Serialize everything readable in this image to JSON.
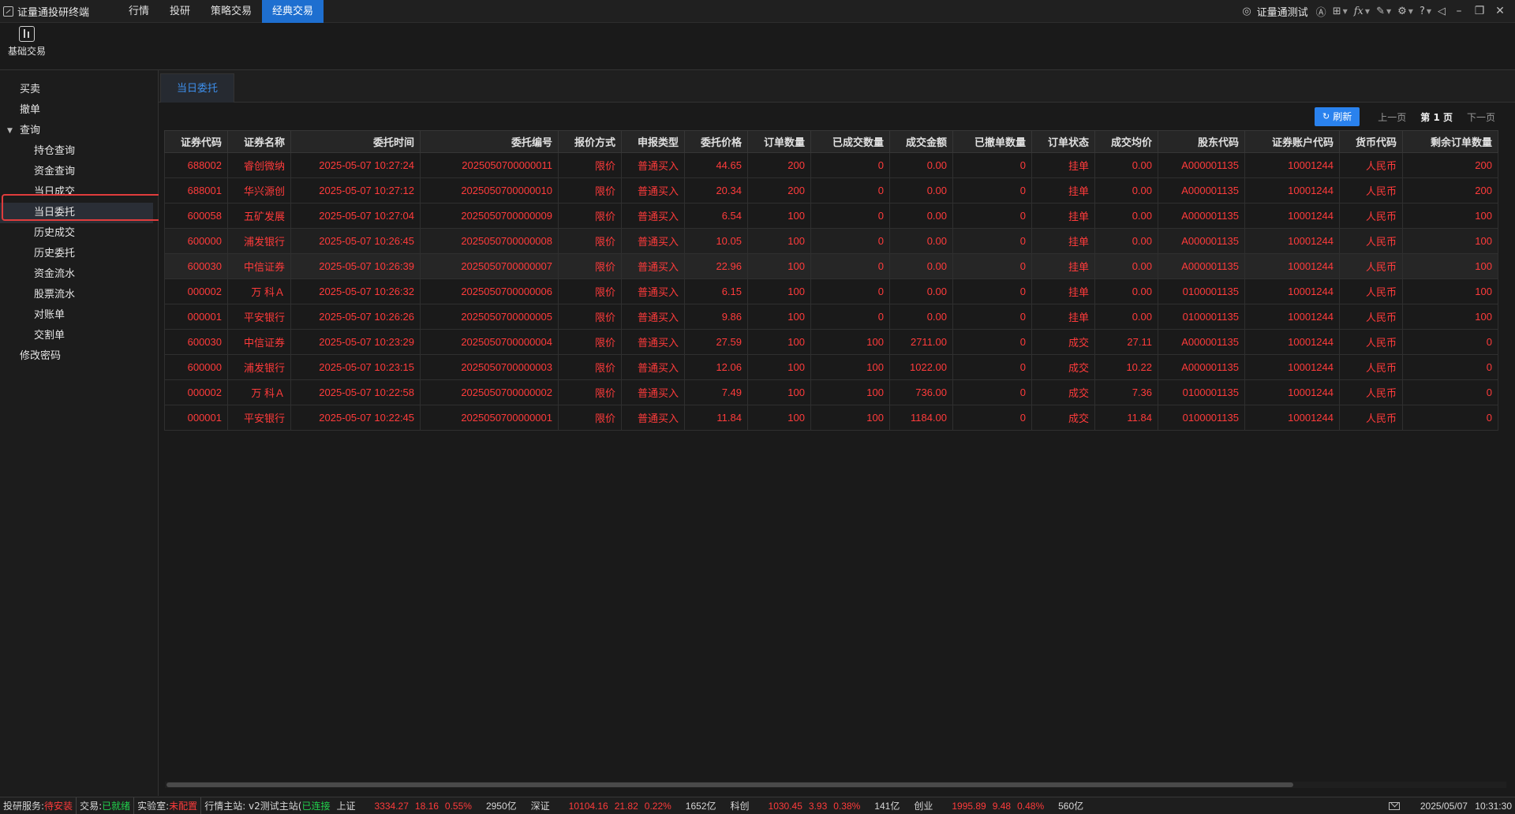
{
  "app": {
    "title": "证量通投研终端",
    "user": "证量通测试",
    "menu": [
      {
        "label": "行情",
        "active": false
      },
      {
        "label": "投研",
        "active": false
      },
      {
        "label": "策略交易",
        "active": false
      },
      {
        "label": "经典交易",
        "active": true
      }
    ]
  },
  "toolbar": {
    "basic_trade_label": "基础交易"
  },
  "sidebar": {
    "items": [
      {
        "label": "买卖",
        "level": 1
      },
      {
        "label": "撤单",
        "level": 1
      },
      {
        "label": "查询",
        "level": 1,
        "expanded": true
      },
      {
        "label": "持仓查询",
        "level": 2
      },
      {
        "label": "资金查询",
        "level": 2
      },
      {
        "label": "当日成交",
        "level": 2
      },
      {
        "label": "当日委托",
        "level": 2,
        "active": true
      },
      {
        "label": "历史成交",
        "level": 2
      },
      {
        "label": "历史委托",
        "level": 2
      },
      {
        "label": "资金流水",
        "level": 2
      },
      {
        "label": "股票流水",
        "level": 2
      },
      {
        "label": "对账单",
        "level": 2
      },
      {
        "label": "交割单",
        "level": 2
      },
      {
        "label": "修改密码",
        "level": 1
      }
    ]
  },
  "main": {
    "tab": "当日委托",
    "refresh_label": "刷新",
    "pager": {
      "prev": "上一页",
      "current": "第 1 页",
      "next": "下一页"
    },
    "columns": [
      "证券代码",
      "证券名称",
      "委托时间",
      "委托编号",
      "报价方式",
      "申报类型",
      "委托价格",
      "订单数量",
      "已成交数量",
      "成交金额",
      "已撤单数量",
      "订单状态",
      "成交均价",
      "股东代码",
      "证券账户代码",
      "货币代码",
      "剩余订单数量"
    ],
    "rows": [
      [
        "688002",
        "睿创微纳",
        "2025-05-07 10:27:24",
        "2025050700000011",
        "限价",
        "普通买入",
        "44.65",
        "200",
        "0",
        "0.00",
        "0",
        "挂单",
        "0.00",
        "A000001135",
        "10001244",
        "人民币",
        "200"
      ],
      [
        "688001",
        "华兴源创",
        "2025-05-07 10:27:12",
        "2025050700000010",
        "限价",
        "普通买入",
        "20.34",
        "200",
        "0",
        "0.00",
        "0",
        "挂单",
        "0.00",
        "A000001135",
        "10001244",
        "人民币",
        "200"
      ],
      [
        "600058",
        "五矿发展",
        "2025-05-07 10:27:04",
        "2025050700000009",
        "限价",
        "普通买入",
        "6.54",
        "100",
        "0",
        "0.00",
        "0",
        "挂单",
        "0.00",
        "A000001135",
        "10001244",
        "人民币",
        "100"
      ],
      [
        "600000",
        "浦发银行",
        "2025-05-07 10:26:45",
        "2025050700000008",
        "限价",
        "普通买入",
        "10.05",
        "100",
        "0",
        "0.00",
        "0",
        "挂单",
        "0.00",
        "A000001135",
        "10001244",
        "人民币",
        "100"
      ],
      [
        "600030",
        "中信证券",
        "2025-05-07 10:26:39",
        "2025050700000007",
        "限价",
        "普通买入",
        "22.96",
        "100",
        "0",
        "0.00",
        "0",
        "挂单",
        "0.00",
        "A000001135",
        "10001244",
        "人民币",
        "100"
      ],
      [
        "000002",
        "万 科Ａ",
        "2025-05-07 10:26:32",
        "2025050700000006",
        "限价",
        "普通买入",
        "6.15",
        "100",
        "0",
        "0.00",
        "0",
        "挂单",
        "0.00",
        "0100001135",
        "10001244",
        "人民币",
        "100"
      ],
      [
        "000001",
        "平安银行",
        "2025-05-07 10:26:26",
        "2025050700000005",
        "限价",
        "普通买入",
        "9.86",
        "100",
        "0",
        "0.00",
        "0",
        "挂单",
        "0.00",
        "0100001135",
        "10001244",
        "人民币",
        "100"
      ],
      [
        "600030",
        "中信证券",
        "2025-05-07 10:23:29",
        "2025050700000004",
        "限价",
        "普通买入",
        "27.59",
        "100",
        "100",
        "2711.00",
        "0",
        "成交",
        "27.11",
        "A000001135",
        "10001244",
        "人民币",
        "0"
      ],
      [
        "600000",
        "浦发银行",
        "2025-05-07 10:23:15",
        "2025050700000003",
        "限价",
        "普通买入",
        "12.06",
        "100",
        "100",
        "1022.00",
        "0",
        "成交",
        "10.22",
        "A000001135",
        "10001244",
        "人民币",
        "0"
      ],
      [
        "000002",
        "万 科Ａ",
        "2025-05-07 10:22:58",
        "2025050700000002",
        "限价",
        "普通买入",
        "7.49",
        "100",
        "100",
        "736.00",
        "0",
        "成交",
        "7.36",
        "0100001135",
        "10001244",
        "人民币",
        "0"
      ],
      [
        "000001",
        "平安银行",
        "2025-05-07 10:22:45",
        "2025050700000001",
        "限价",
        "普通买入",
        "11.84",
        "100",
        "100",
        "1184.00",
        "0",
        "成交",
        "11.84",
        "0100001135",
        "10001244",
        "人民币",
        "0"
      ]
    ]
  },
  "status": {
    "research_label": "投研服务:",
    "research_value": "待安装",
    "trade_label": "交易:",
    "trade_value": "已就绪",
    "lab_label": "实验室:",
    "lab_value": "未配置",
    "quote_label": "行情主站: v2测试主站(",
    "quote_value": "已连接",
    "indices": [
      {
        "name": "上证",
        "value": "3334.27",
        "change": "18.16",
        "pct": "0.55%",
        "amount": "2950亿"
      },
      {
        "name": "深证",
        "value": "10104.16",
        "change": "21.82",
        "pct": "0.22%",
        "amount": "1652亿"
      },
      {
        "name": "科创",
        "value": "1030.45",
        "change": "3.93",
        "pct": "0.38%",
        "amount": "141亿"
      },
      {
        "name": "创业",
        "value": "1995.89",
        "change": "9.48",
        "pct": "0.48%",
        "amount": "560亿"
      }
    ],
    "date": "2025/05/07",
    "time": "10:31:30"
  },
  "colors": {
    "accent": "#1e6fd0",
    "up": "#ff3b3b",
    "ok": "#21d24c",
    "highlight": "#e03c3c"
  }
}
